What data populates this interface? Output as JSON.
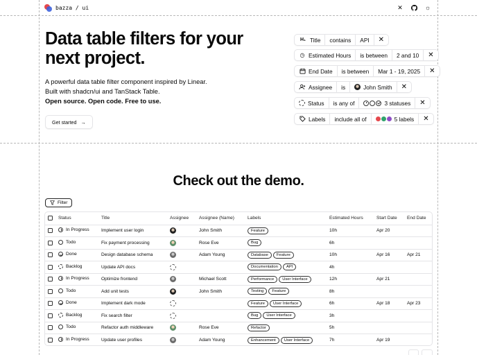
{
  "header": {
    "brand": "bazza / ui",
    "icons": [
      "x-icon",
      "github-icon",
      "theme-toggle-icon"
    ]
  },
  "hero": {
    "title": "Data table filters for your next project.",
    "desc_line1": "A powerful data table filter component inspired by Linear.",
    "desc_line2": "Built with shadcn/ui and TanStack Table.",
    "desc_line3": "Open source. Open code. Free to use.",
    "cta": "Get started"
  },
  "chips": [
    {
      "field": "Title",
      "op": "contains",
      "value": "API"
    },
    {
      "field": "Estimated Hours",
      "op": "is between",
      "value": "2 and 10"
    },
    {
      "field": "End Date",
      "op": "is between",
      "value": "Mar 1 - 19, 2025"
    },
    {
      "field": "Assignee",
      "op": "is",
      "value": "John Smith"
    },
    {
      "field": "Status",
      "op": "is any of",
      "value": "3 statuses"
    },
    {
      "field": "Labels",
      "op": "include all of",
      "value": "5 labels"
    }
  ],
  "label_colors": [
    "#e5484d",
    "#30a46c",
    "#8e4ec6"
  ],
  "demo": {
    "title": "Check out the demo.",
    "filter_button": "Filter"
  },
  "table": {
    "columns": [
      "Status",
      "Title",
      "Assignee",
      "Assignee (Name)",
      "Labels",
      "Estimated Hours",
      "Start Date",
      "End Date"
    ],
    "rows": [
      {
        "status": "In Progress",
        "title": "Implement user login",
        "avatar": "dark",
        "assignee": "John Smith",
        "labels": [
          "Feature"
        ],
        "hours": "10h",
        "start": "Apr 20",
        "end": ""
      },
      {
        "status": "Todo",
        "title": "Fix payment processing",
        "avatar": "green",
        "assignee": "Rose Eve",
        "labels": [
          "Bug"
        ],
        "hours": "6h",
        "start": "",
        "end": ""
      },
      {
        "status": "Done",
        "title": "Design database schema",
        "avatar": "gray",
        "assignee": "Adam Young",
        "labels": [
          "Database",
          "Feature"
        ],
        "hours": "10h",
        "start": "Apr 16",
        "end": "Apr 21"
      },
      {
        "status": "Backlog",
        "title": "Update API docs",
        "avatar": "empty",
        "assignee": "",
        "labels": [
          "Documentation",
          "API"
        ],
        "hours": "4h",
        "start": "",
        "end": ""
      },
      {
        "status": "In Progress",
        "title": "Optimize frontend",
        "avatar": "gray",
        "assignee": "Michael Scott",
        "labels": [
          "Performance",
          "User Interface"
        ],
        "hours": "12h",
        "start": "Apr 21",
        "end": ""
      },
      {
        "status": "Todo",
        "title": "Add unit tests",
        "avatar": "dark",
        "assignee": "John Smith",
        "labels": [
          "Testing",
          "Feature"
        ],
        "hours": "8h",
        "start": "",
        "end": ""
      },
      {
        "status": "Done",
        "title": "Implement dark mode",
        "avatar": "empty",
        "assignee": "",
        "labels": [
          "Feature",
          "User Interface"
        ],
        "hours": "6h",
        "start": "Apr 18",
        "end": "Apr 23"
      },
      {
        "status": "Backlog",
        "title": "Fix search filter",
        "avatar": "empty",
        "assignee": "",
        "labels": [
          "Bug",
          "User Interface"
        ],
        "hours": "3h",
        "start": "",
        "end": ""
      },
      {
        "status": "Todo",
        "title": "Refactor auth middleware",
        "avatar": "green",
        "assignee": "Rose Eve",
        "labels": [
          "Refactor"
        ],
        "hours": "5h",
        "start": "",
        "end": ""
      },
      {
        "status": "In Progress",
        "title": "Update user profiles",
        "avatar": "gray",
        "assignee": "Adam Young",
        "labels": [
          "Enhancement",
          "User Interface"
        ],
        "hours": "7h",
        "start": "Apr 19",
        "end": ""
      }
    ]
  }
}
